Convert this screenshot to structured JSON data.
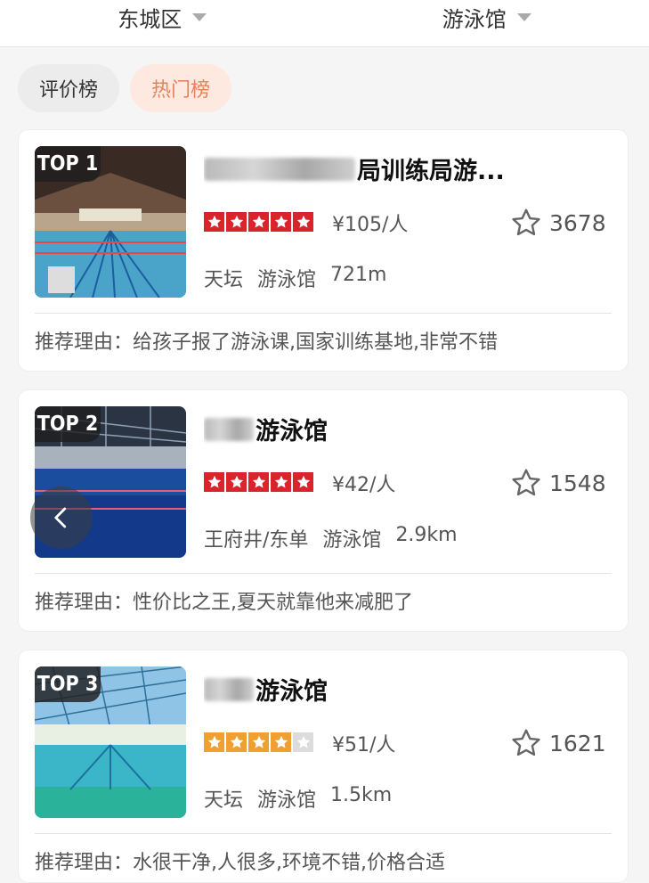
{
  "filters": {
    "district": "东城区",
    "category": "游泳馆"
  },
  "tabs": [
    {
      "label": "评价榜",
      "active": false
    },
    {
      "label": "热门榜",
      "active": true
    }
  ],
  "colors": {
    "star_red": "#d9242c",
    "star_orange": "#f0a030",
    "star_empty": "#dcdcdc",
    "tab_active": "#e8825c"
  },
  "venues": [
    {
      "rank": "TOP 1",
      "title_suffix": "局训练局游...",
      "rating_stars": 5,
      "star_color": "red",
      "price": "¥105/人",
      "favorites": "3678",
      "area": "天坛",
      "category": "游泳馆",
      "distance": "721m",
      "reason": "推荐理由：给孩子报了游泳课,国家训练基地,非常不错"
    },
    {
      "rank": "TOP 2",
      "title_suffix": "游泳馆",
      "rating_stars": 5,
      "star_color": "red",
      "price": "¥42/人",
      "favorites": "1548",
      "area": "王府井/东单",
      "category": "游泳馆",
      "distance": "2.9km",
      "reason": "推荐理由：性价比之王,夏天就靠他来减肥了"
    },
    {
      "rank": "TOP 3",
      "title_suffix": "游泳馆",
      "rating_stars": 4,
      "star_color": "orange",
      "price": "¥51/人",
      "favorites": "1621",
      "area": "天坛",
      "category": "游泳馆",
      "distance": "1.5km",
      "reason": "推荐理由：水很干净,人很多,环境不错,价格合适"
    }
  ],
  "icons": {
    "favorite": "star-outline-icon",
    "back": "chevron-left-icon",
    "dropdown": "caret-down-icon"
  }
}
